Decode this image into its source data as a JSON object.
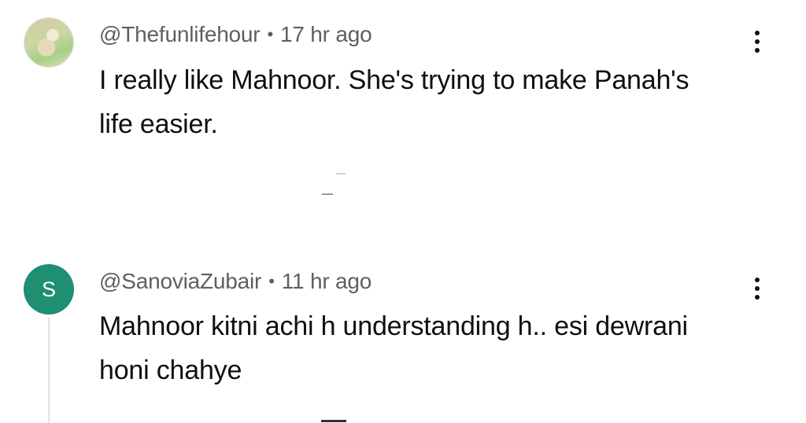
{
  "comments": [
    {
      "avatar_type": "photo",
      "username": "@Thefunlifehour",
      "separator": "•",
      "time": "17 hr ago",
      "text": "I really like Mahnoor. She's trying to make Panah's life easier.",
      "more_icon": "more-vertical-icon"
    },
    {
      "avatar_type": "letter",
      "avatar_letter": "S",
      "avatar_color": "#1e8f70",
      "username": "@SanoviaZubair",
      "separator": "•",
      "time": "11 hr ago",
      "text": "Mahnoor kitni achi h understanding h.. esi dewrani honi chahye",
      "more_icon": "more-vertical-icon"
    }
  ]
}
